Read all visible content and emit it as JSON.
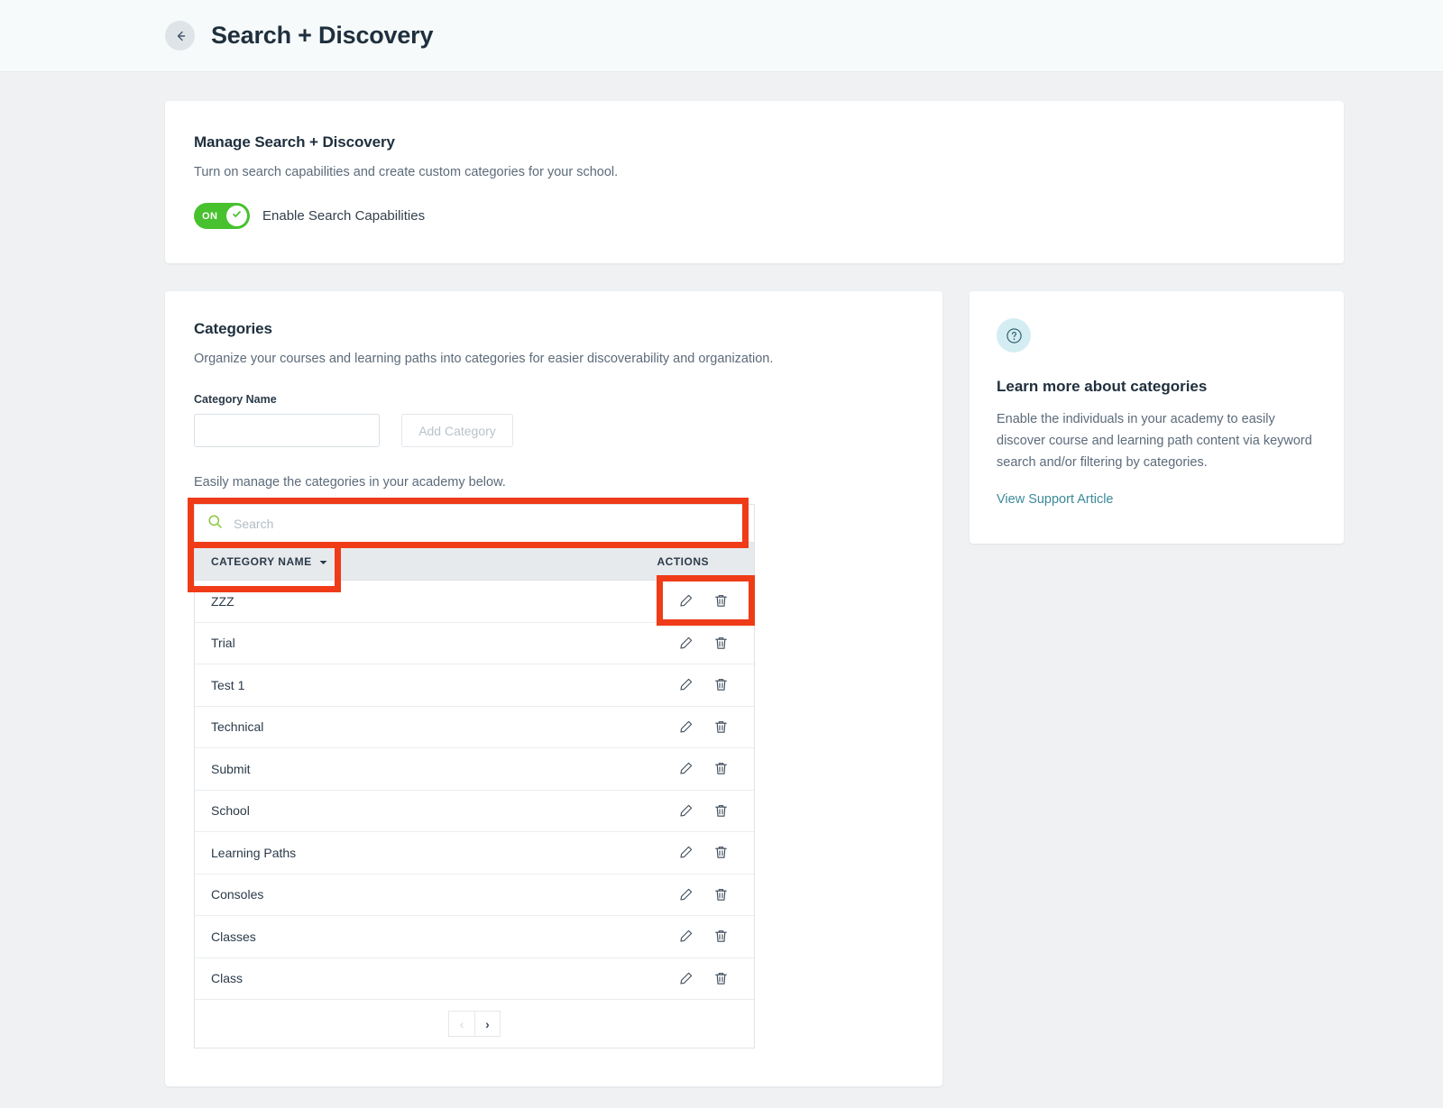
{
  "header": {
    "title": "Search + Discovery",
    "back_icon": "arrow-left-icon"
  },
  "manage": {
    "title": "Manage Search + Discovery",
    "subtitle": "Turn on search capabilities and create custom categories for your school.",
    "toggle": {
      "state_label": "ON",
      "enabled": true,
      "label": "Enable Search Capabilities",
      "on_color": "#47c12e",
      "check_icon": "check-icon"
    }
  },
  "categories": {
    "title": "Categories",
    "subtitle": "Organize your courses and learning paths into categories for easier discoverability and organization.",
    "field_label": "Category Name",
    "input_value": "",
    "input_placeholder": "",
    "add_button": "Add Category",
    "add_button_disabled": true,
    "manage_note": "Easily manage the categories in your academy below.",
    "search": {
      "placeholder": "Search",
      "value": "",
      "icon": "search-icon",
      "icon_color": "#7cbf4f"
    },
    "table": {
      "columns": [
        "CATEGORY NAME",
        "ACTIONS"
      ],
      "sort_icon": "caret-down-icon",
      "sort_column": "CATEGORY NAME",
      "sort_direction": "descending",
      "row_actions": [
        "edit-pencil-icon",
        "trash-icon"
      ],
      "rows": [
        {
          "name": "ZZZ"
        },
        {
          "name": "Trial"
        },
        {
          "name": "Test 1"
        },
        {
          "name": "Technical"
        },
        {
          "name": "Submit"
        },
        {
          "name": "School"
        },
        {
          "name": "Learning Paths"
        },
        {
          "name": "Consoles"
        },
        {
          "name": "Classes"
        },
        {
          "name": "Class"
        }
      ]
    },
    "pagination": {
      "prev_label": "‹",
      "next_label": "›",
      "prev_disabled": true,
      "next_disabled": false
    }
  },
  "info_panel": {
    "icon": "question-mark-icon",
    "title": "Learn more about categories",
    "body": "Enable the individuals in your academy to easily discover course and learning path content via keyword search and/or filtering by categories.",
    "link": "View Support Article",
    "link_color": "#3c8a9b"
  },
  "annotations": {
    "highlight_color": "#ef3b18",
    "boxes": [
      {
        "name": "search-input-highlight"
      },
      {
        "name": "category-name-header-highlight"
      },
      {
        "name": "row-actions-highlight"
      }
    ]
  }
}
